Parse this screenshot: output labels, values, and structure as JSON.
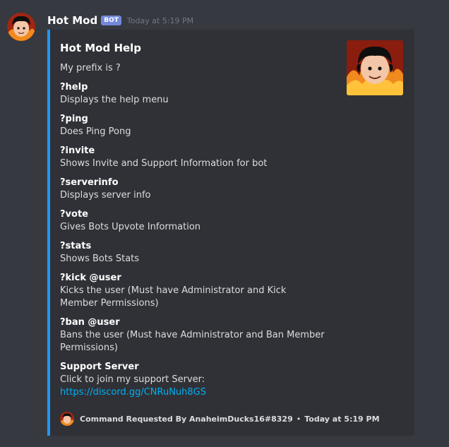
{
  "message": {
    "username": "Hot Mod",
    "bot_tag": "BOT",
    "timestamp": "Today at 5:19 PM"
  },
  "embed": {
    "accent_color": "#2196f3",
    "title": "Hot Mod Help",
    "description": "My prefix is ?",
    "fields": [
      {
        "name": "?help",
        "value": "Displays the help menu"
      },
      {
        "name": "?ping",
        "value": "Does Ping Pong"
      },
      {
        "name": "?invite",
        "value": "Shows Invite and Support Information for bot"
      },
      {
        "name": "?serverinfo",
        "value": "Displays server info"
      },
      {
        "name": "?vote",
        "value": "Gives Bots Upvote Information"
      },
      {
        "name": "?stats",
        "value": "Shows Bots Stats"
      },
      {
        "name": "?kick @user",
        "value_line1": "Kicks the user (Must have Administrator and Kick",
        "value_line2": "Member Permissions)"
      },
      {
        "name": "?ban @user",
        "value_line1": "Bans the user (Must have Administrator and Ban Member",
        "value_line2": "Permissions)"
      },
      {
        "name": "Support Server",
        "value_line1": "Click to join my support Server:",
        "link": "https://discord.gg/CNRuNuh8GS"
      }
    ],
    "footer": {
      "text": "Command Requested By AnaheimDucks16#8329",
      "separator": "•",
      "time": "Today at 5:19 PM"
    }
  }
}
